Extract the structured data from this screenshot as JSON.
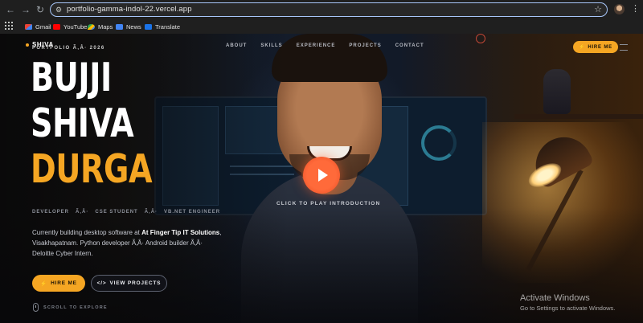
{
  "browser": {
    "url": "portfolio-gamma-indol-22.vercel.app",
    "bookmarks": [
      "Gmail",
      "YouTube",
      "Maps",
      "News",
      "Translate"
    ]
  },
  "site": {
    "logo": "SHIVA",
    "portfolio_tag": "PORTFOLIO Ã‚Â· 2026",
    "nav": [
      "ABOUT",
      "SKILLS",
      "EXPERIENCE",
      "PROJECTS",
      "CONTACT"
    ],
    "hire_top": "HIRE ME"
  },
  "hero": {
    "name_line1": "BUJJI",
    "name_line2": "SHIVA",
    "name_line3": "DURGA",
    "roles": [
      "DEVELOPER",
      "Ã‚Â·",
      "CSE STUDENT",
      "Ã‚Â·",
      "VB.NET ENGINEER"
    ],
    "bio_pre": "Currently building desktop software at ",
    "bio_company": "At Finger Tip IT Solutions",
    "bio_post": ", Visakhapatnam. Python developer Ã‚Â· Android builder Ã‚Â· Deloitte Cyber Intern.",
    "btn_hire": "HIRE ME",
    "btn_projects": "VIEW PROJECTS",
    "scroll_hint": "SCROLL TO EXPLORE",
    "play_caption": "CLICK TO PLAY INTRODUCTION"
  },
  "windows_watermark": {
    "title": "Activate Windows",
    "subtitle": "Go to Settings to activate Windows."
  },
  "colors": {
    "accent": "#f5a623",
    "play": "#ff6a3a",
    "omnibox_border": "#a8c7fa"
  }
}
